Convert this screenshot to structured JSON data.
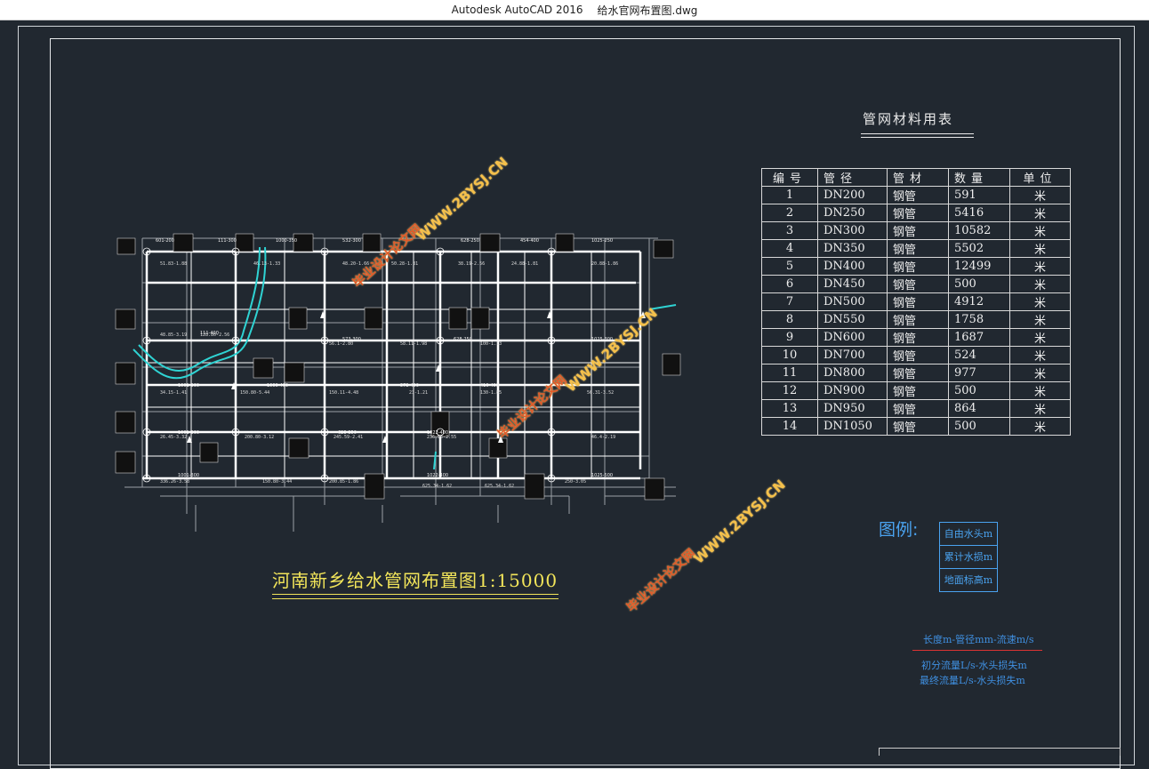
{
  "window": {
    "app_title": "Autodesk AutoCAD 2016",
    "file_name": "给水官网布置图.dwg"
  },
  "material_table": {
    "title": "管网材料用表",
    "headers": [
      "编号",
      "管径",
      "管材",
      "数量",
      "单位"
    ],
    "rows": [
      [
        "1",
        "DN200",
        "钢管",
        "591",
        "米"
      ],
      [
        "2",
        "DN250",
        "钢管",
        "5416",
        "米"
      ],
      [
        "3",
        "DN300",
        "钢管",
        "10582",
        "米"
      ],
      [
        "4",
        "DN350",
        "钢管",
        "5502",
        "米"
      ],
      [
        "5",
        "DN400",
        "钢管",
        "12499",
        "米"
      ],
      [
        "6",
        "DN450",
        "钢管",
        "500",
        "米"
      ],
      [
        "7",
        "DN500",
        "钢管",
        "4912",
        "米"
      ],
      [
        "8",
        "DN550",
        "钢管",
        "1758",
        "米"
      ],
      [
        "9",
        "DN600",
        "钢管",
        "1687",
        "米"
      ],
      [
        "10",
        "DN700",
        "钢管",
        "524",
        "米"
      ],
      [
        "11",
        "DN800",
        "钢管",
        "977",
        "米"
      ],
      [
        "12",
        "DN900",
        "钢管",
        "500",
        "米"
      ],
      [
        "13",
        "DN950",
        "钢管",
        "864",
        "米"
      ],
      [
        "14",
        "DN1050",
        "钢管",
        "500",
        "米"
      ]
    ]
  },
  "drawing_title": "河南新乡给水管网布置图1:15000",
  "legend": {
    "label": "图例:",
    "items": [
      "自由水头m",
      "累计水损m",
      "地面标高m"
    ]
  },
  "pipe_notation": {
    "line1": "长度m-管径mm-流速m/s",
    "line2": "初分流量L/s-水头损失m",
    "line3": "最终流量L/s-水头损失m"
  },
  "watermarks": {
    "text_a": "毕业设计论文网",
    "text_b": "WWW.2BYSJ.CN"
  },
  "colors": {
    "background": "#212830",
    "table_text": "#eeeeee",
    "title": "#f2e55a",
    "legend": "#4aa3f0",
    "river": "#2fd3d3",
    "watermark": "#e05a2a"
  }
}
